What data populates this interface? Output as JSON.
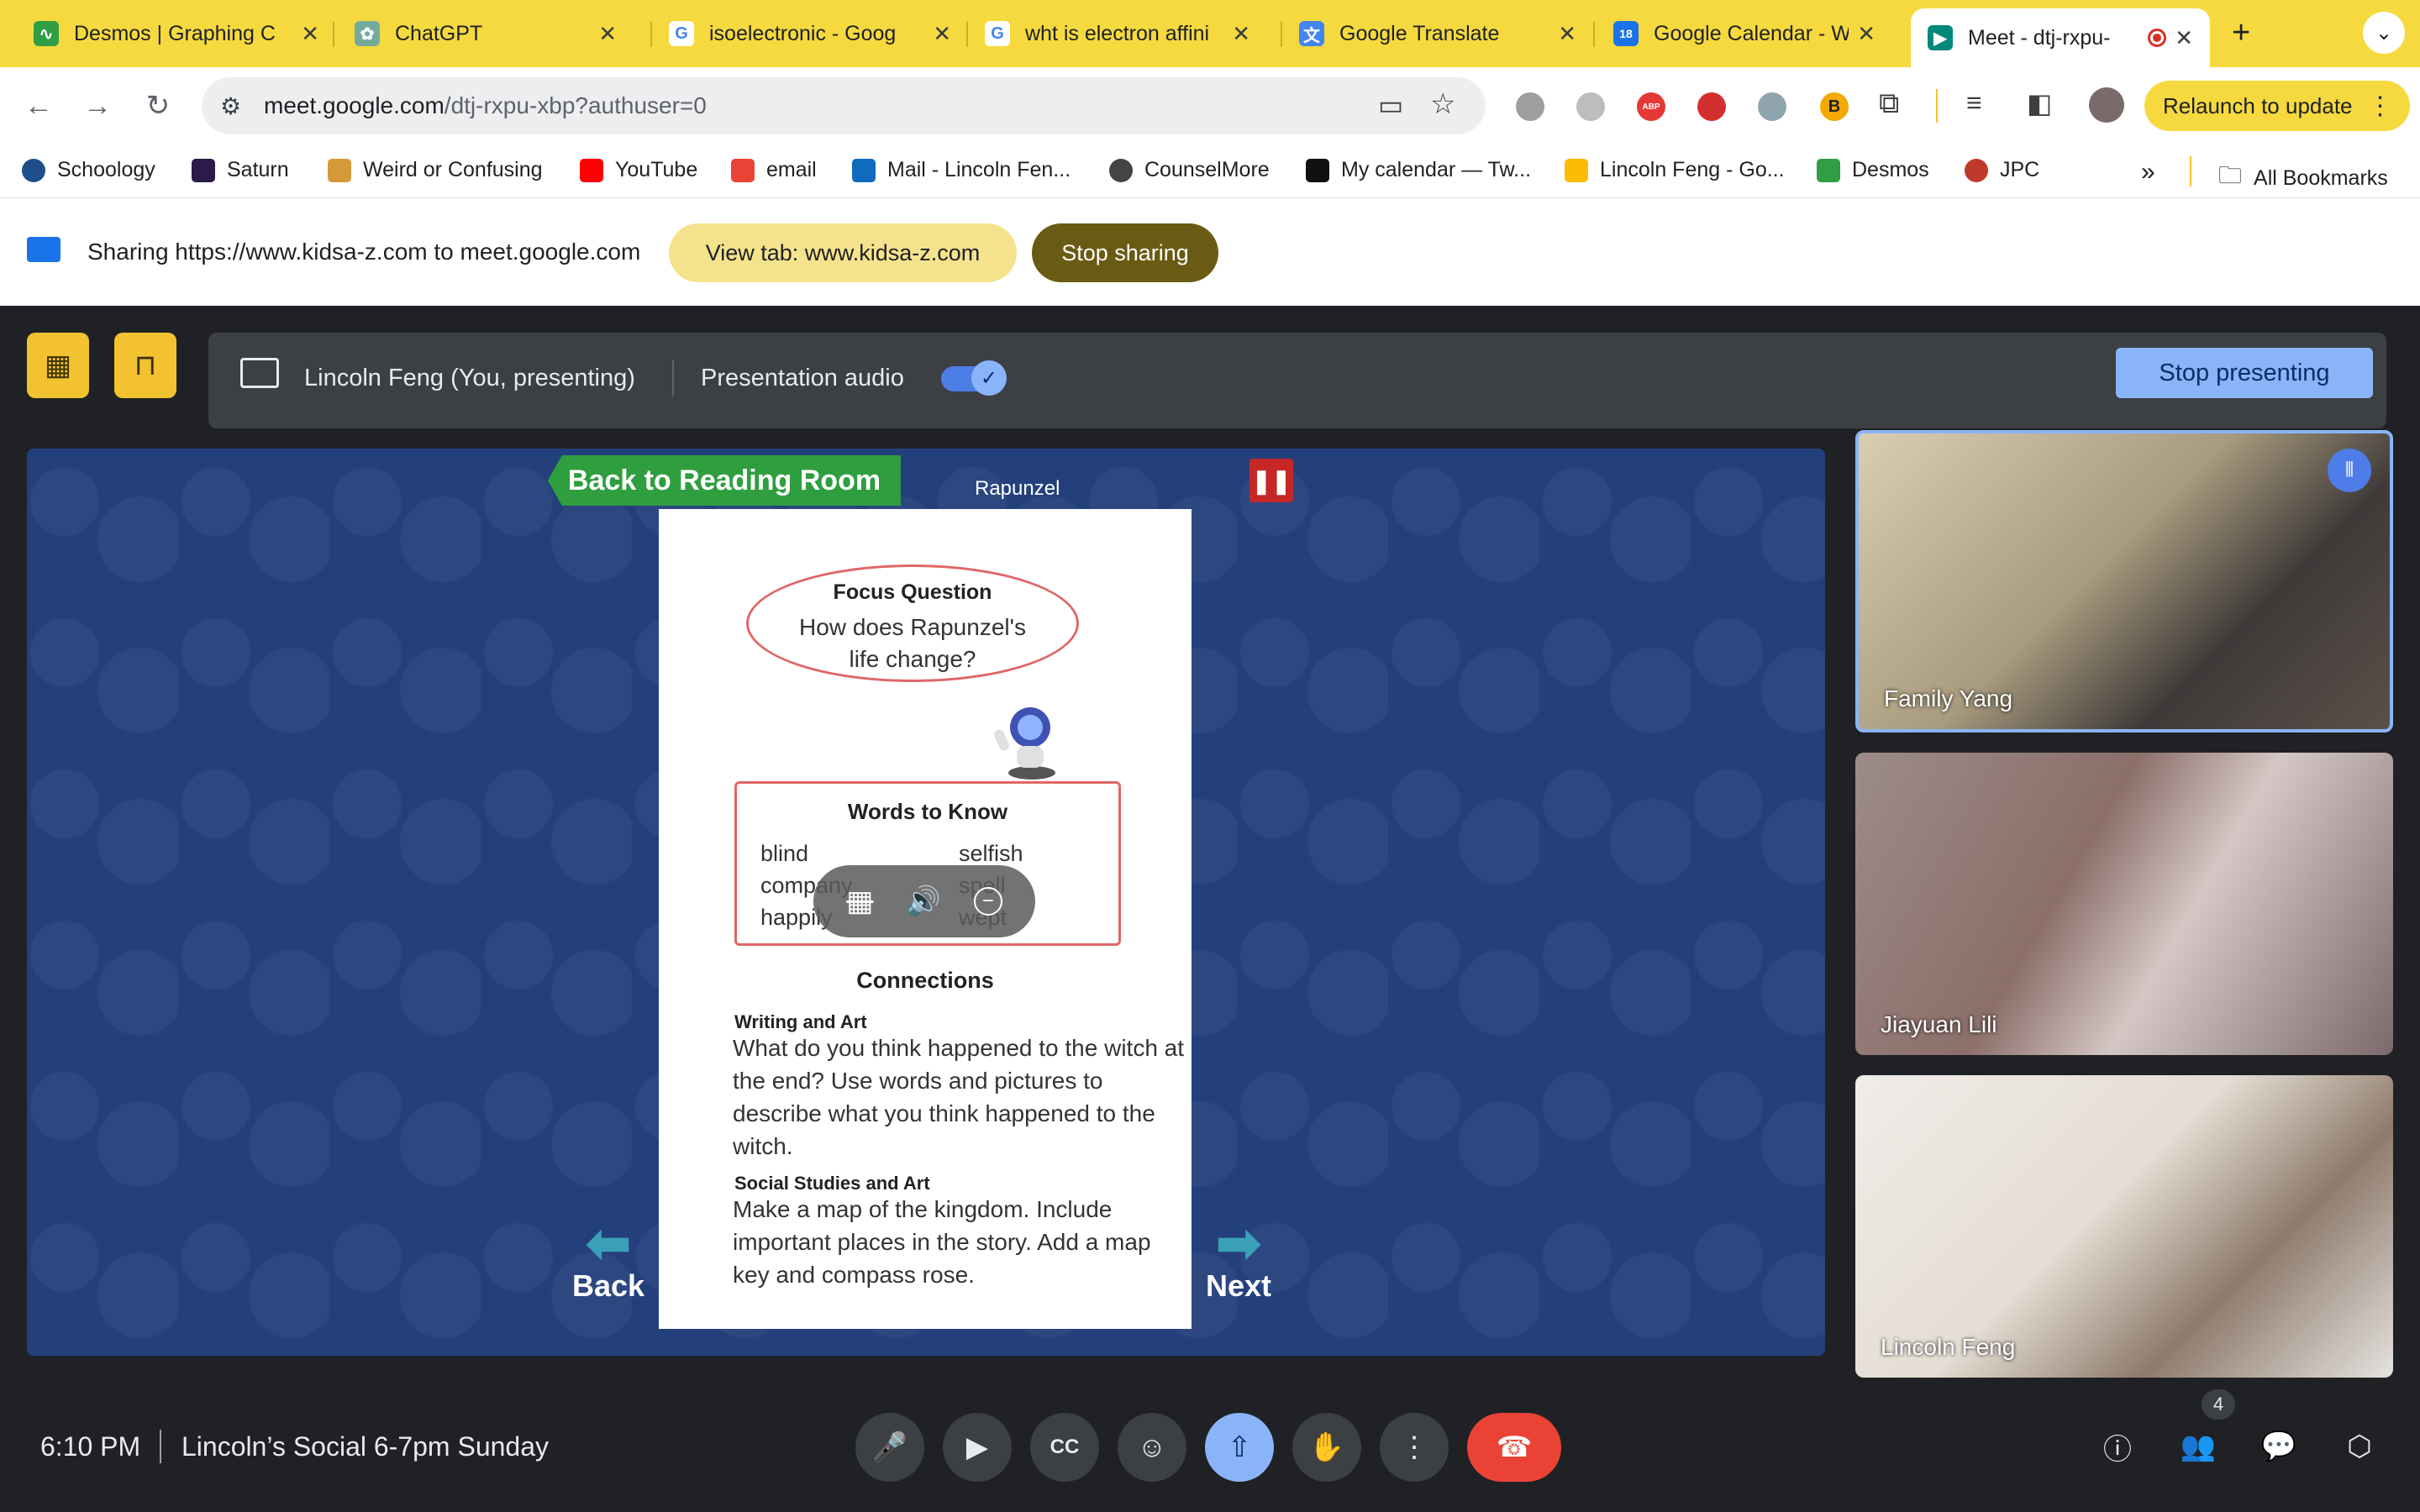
{
  "tabs": [
    {
      "title": "Desmos | Graphing C",
      "favicon_color": "#2f9e44"
    },
    {
      "title": "ChatGPT",
      "favicon_color": "#74aa9c"
    },
    {
      "title": "isoelectronic - Goog",
      "favicon_color": "#4285f4"
    },
    {
      "title": "wht is electron affini",
      "favicon_color": "#4285f4"
    },
    {
      "title": "Google Translate",
      "favicon_color": "#4285f4"
    },
    {
      "title": "Google Calendar - W",
      "favicon_color": "#1a73e8"
    },
    {
      "title": "Meet - dtj-rxpu-",
      "favicon_color": "#00897b"
    }
  ],
  "toolbar": {
    "url_main": "meet.google.com",
    "url_rest": "/dtj-rxpu-xbp?authuser=0",
    "relaunch_label": "Relaunch to update"
  },
  "bookmarks": [
    {
      "label": "Schoology",
      "color": "#1f4f8b"
    },
    {
      "label": "Saturn",
      "color": "#2b1a4a"
    },
    {
      "label": "Weird or Confusing",
      "color": "#d49a3a"
    },
    {
      "label": "YouTube",
      "color": "#ff0000"
    },
    {
      "label": "email",
      "color": "#ea4335"
    },
    {
      "label": "Mail - Lincoln Fen...",
      "color": "#0f6cbd"
    },
    {
      "label": "CounselMore",
      "color": "#444444"
    },
    {
      "label": "My calendar — Tw...",
      "color": "#111111"
    },
    {
      "label": "Lincoln Feng - Go...",
      "color": "#fbbc04"
    },
    {
      "label": "Desmos",
      "color": "#2f9e44"
    },
    {
      "label": "JPC",
      "color": "#c0392b"
    }
  ],
  "bookmarks_all": "All Bookmarks",
  "share": {
    "text": "Sharing https://www.kidsa-z.com to meet.google.com",
    "view_tab": "View tab: www.kidsa-z.com",
    "stop_sharing": "Stop sharing"
  },
  "presenting": {
    "name": "Lincoln Feng (You, presenting)",
    "audio_label": "Presentation audio",
    "stop_label": "Stop presenting"
  },
  "book": {
    "back_to_room": "Back to Reading Room",
    "title": "Rapunzel",
    "focus_title": "Focus Question",
    "focus_text": "How does Rapunzel's life change?",
    "words_title": "Words to Know",
    "words": [
      "blind",
      "selfish",
      "company",
      "spell",
      "happily",
      "wept"
    ],
    "connections_title": "Connections",
    "writing_title": "Writing and Art",
    "writing_text": "What do you think happened to the witch at the end? Use words and pictures to describe what you think happened to the witch.",
    "social_title": "Social Studies and Art",
    "social_text": "Make a map of the kingdom. Include important places in the story. Add a map key and  compass rose.",
    "back_label": "Back",
    "next_label": "Next"
  },
  "participants": [
    {
      "name": "Family Yang"
    },
    {
      "name": "Jiayuan Lili"
    },
    {
      "name": "Lincoln Feng"
    }
  ],
  "meeting": {
    "time": "6:10 PM",
    "title": "Lincoln’s Social 6-7pm Sunday",
    "participant_count": "4"
  }
}
